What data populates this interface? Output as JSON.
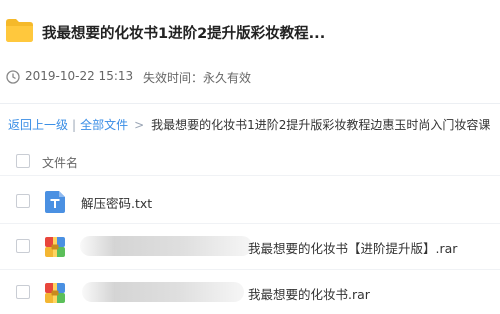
{
  "header": {
    "title": "我最想要的化妆书1进阶2提升版彩妆教程...",
    "folder_icon": "folder-icon"
  },
  "meta": {
    "date": "2019-10-22 15:13",
    "expire": "失效时间：永久有效",
    "clock_icon": "clock-icon"
  },
  "breadcrumb": {
    "back": "返回上一级",
    "separator": "|",
    "all_files": "全部文件",
    "arrow": ">",
    "current": "我最想要的化妆书1进阶2提升版彩妆教程边惠玉时尚入门妆容课"
  },
  "table": {
    "header_label": "文件名",
    "rows": [
      {
        "name": "解压密码.txt",
        "icon": "txt-file-icon"
      },
      {
        "name": "我最想要的化妆书【进阶提升版】.rar",
        "icon": "rar-archive-icon"
      },
      {
        "name": "我最想要的化妆书.rar",
        "icon": "rar-archive-icon"
      }
    ]
  },
  "colors": {
    "link": "#3a8ee6",
    "folder": "#ffc83d",
    "txt_icon": "#4a90e2",
    "divider": "#eceff3"
  }
}
